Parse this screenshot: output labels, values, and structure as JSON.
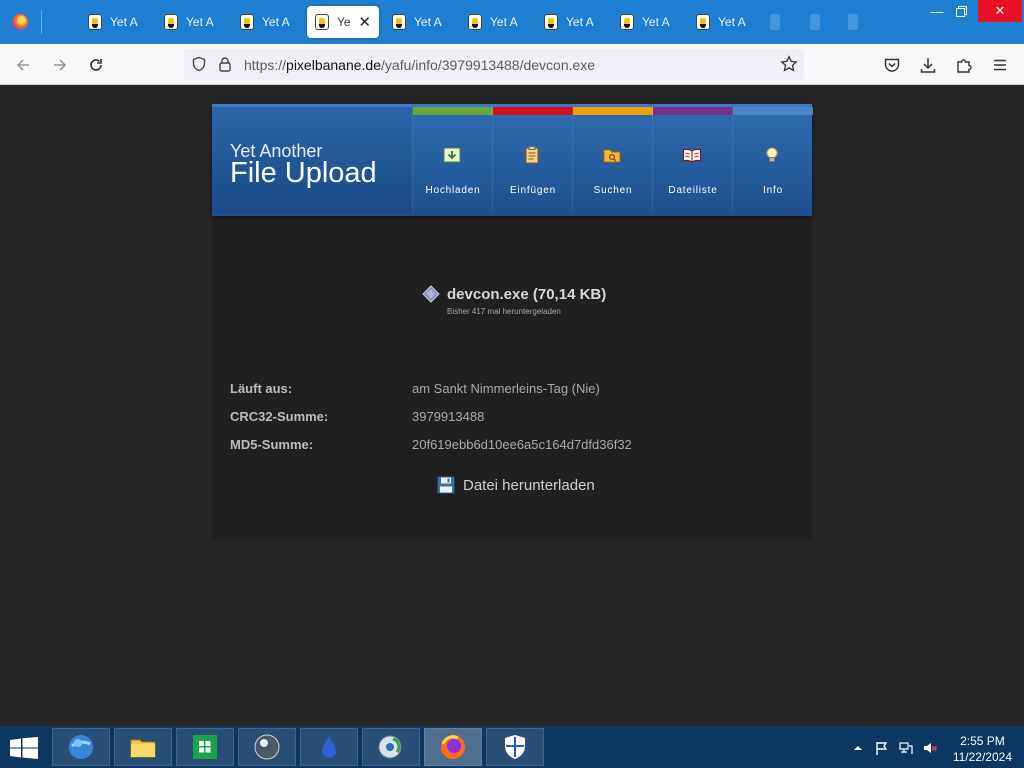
{
  "browser": {
    "tabs": [
      {
        "label": "Yet A"
      },
      {
        "label": "Yet A"
      },
      {
        "label": "Yet A"
      },
      {
        "label": "Ye"
      },
      {
        "label": "Yet A"
      },
      {
        "label": "Yet A"
      },
      {
        "label": "Yet A"
      },
      {
        "label": "Yet A"
      },
      {
        "label": "Yet A"
      }
    ],
    "url_prefix": "https://",
    "url_host": "pixelbanane.de",
    "url_path": "/yafu/info/3979913488/devcon.exe"
  },
  "site": {
    "logo_small": "Yet Another",
    "logo_big": "File Upload",
    "menu": [
      {
        "label": "Hochladen",
        "color": "#6aa83b",
        "icon": "upload-icon"
      },
      {
        "label": "Einfügen",
        "color": "#d4121e",
        "icon": "clipboard-icon"
      },
      {
        "label": "Suchen",
        "color": "#f0a10a",
        "icon": "folder-search-icon"
      },
      {
        "label": "Dateiliste",
        "color": "#7a2f8f",
        "icon": "book-icon"
      },
      {
        "label": "Info",
        "color": "#4a83c6",
        "icon": "lightbulb-icon"
      }
    ]
  },
  "file": {
    "title": "devcon.exe (70,14 KB)",
    "downloads": "Bisher 417 mal heruntergeladen",
    "details": [
      {
        "label": "Läuft aus:",
        "value": "am Sankt Nimmerleins-Tag (Nie)"
      },
      {
        "label": "CRC32-Summe:",
        "value": "3979913488"
      },
      {
        "label": "MD5-Summe:",
        "value": "20f619ebb6d10ee6a5c164d7dfd36f32"
      }
    ],
    "download_label": "Datei herunterladen"
  },
  "taskbar": {
    "apps": [
      "ie-icon",
      "explorer-icon",
      "store-icon",
      "media-icon",
      "app-icon",
      "network-icon",
      "firefox-icon",
      "defender-icon"
    ],
    "time": "2:55 PM",
    "date": "11/22/2024"
  }
}
